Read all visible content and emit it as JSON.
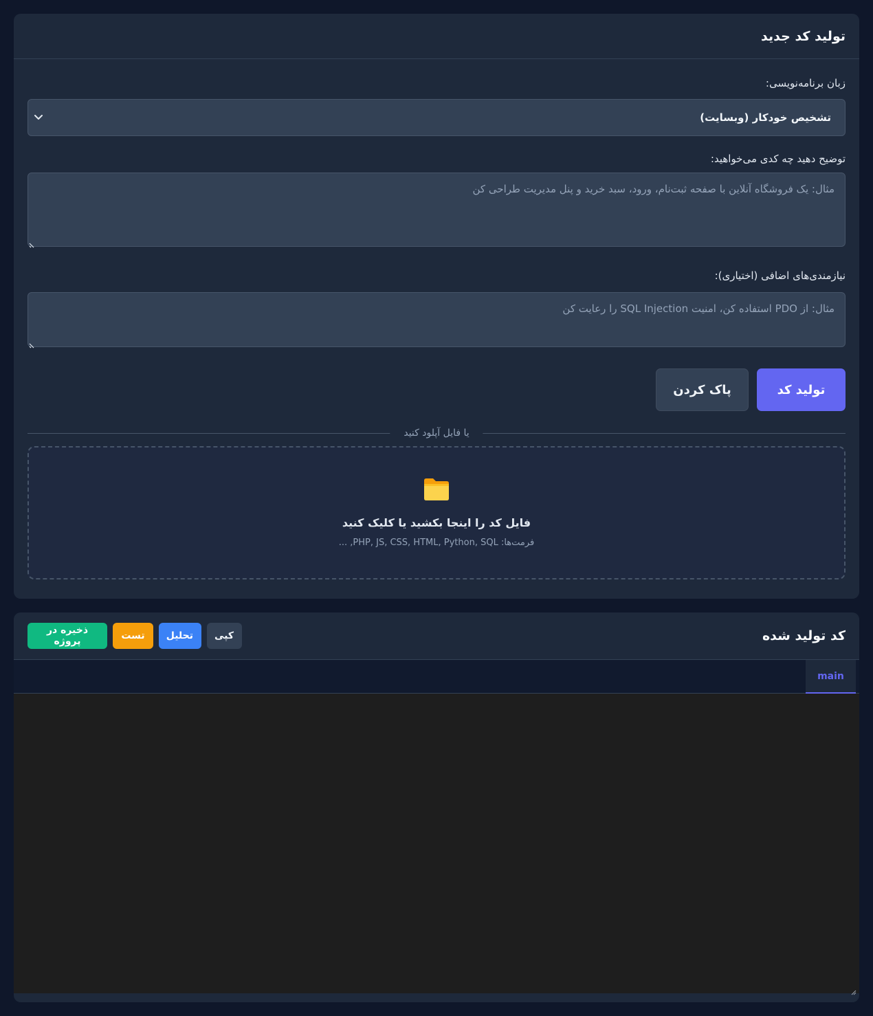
{
  "generator": {
    "title": "تولید کد جدید",
    "language_label": "زبان برنامه‌نویسی:",
    "language_value": "تشخیص خودکار (وبسایت)",
    "description_label": "توضیح دهید چه کدی می‌خواهید:",
    "description_placeholder": "مثال: یک فروشگاه آنلاین با صفحه ثبت‌نام، ورود، سبد خرید و پنل مدیریت طراحی کن",
    "requirements_label": "نیازمندی‌های اضافی (اختیاری):",
    "requirements_placeholder": "مثال: از PDO استفاده کن، امنیت SQL Injection را رعایت کن",
    "generate_button": "تولید کد",
    "clear_button": "پاک کردن",
    "divider_text": "یا فایل آپلود کنید",
    "dropzone_title": "فایل کد را اینجا بکشید یا کلیک کنید",
    "dropzone_formats": "فرمت‌ها: PHP, JS, CSS, HTML, Python, SQL, ..."
  },
  "output": {
    "title": "کد تولید شده",
    "copy_button": "کپی",
    "analyze_button": "تحلیل",
    "test_button": "تست",
    "save_button": "ذخیره در پروژه",
    "tabs": [
      "main"
    ]
  },
  "colors": {
    "accent": "#6366f1",
    "analyze": "#3b82f6",
    "test": "#f59e0b",
    "save": "#10b981",
    "folder": "#fbbf24"
  },
  "icons": [
    "chevron-down-icon",
    "folder-icon",
    "resize-grip-icon"
  ]
}
